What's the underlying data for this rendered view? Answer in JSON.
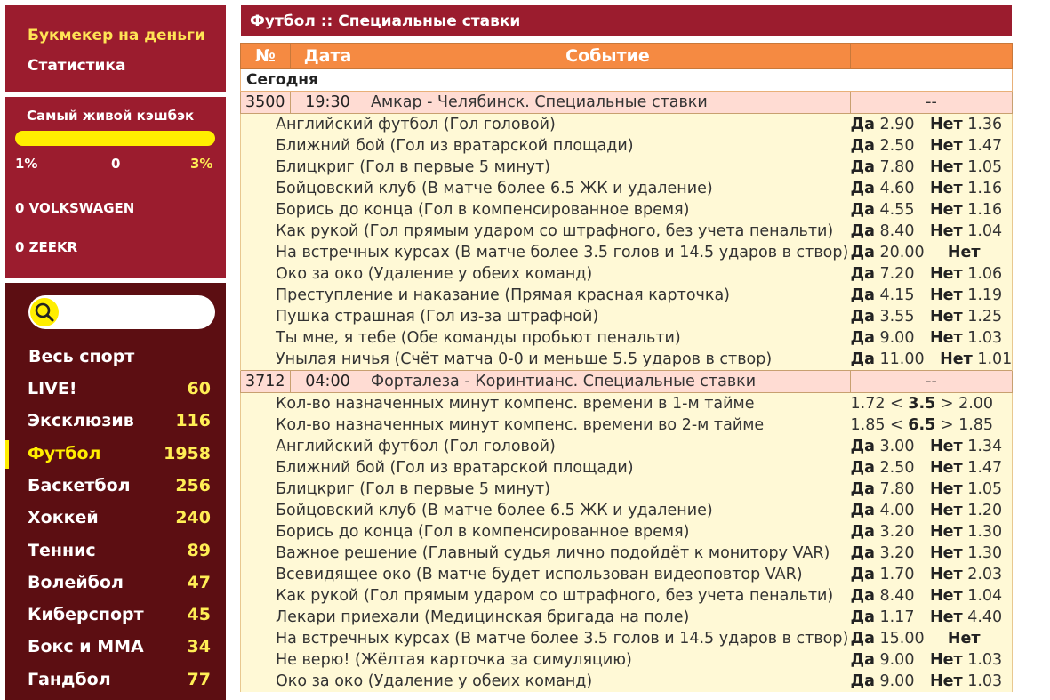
{
  "sidebar": {
    "links": [
      "Букмекер на деньги",
      "Статистика"
    ],
    "cashback": {
      "title": "Самый живой кэшбэк",
      "left": "1%",
      "middle": "0",
      "right": "3%",
      "progress": 0
    },
    "cars": [
      "0 VOLKSWAGEN",
      "0 ZEEKR"
    ],
    "search_placeholder": "",
    "all_sport": "Весь спорт",
    "sports": [
      {
        "name": "LIVE!",
        "count": "60"
      },
      {
        "name": "Эксклюзив",
        "count": "116"
      },
      {
        "name": "Футбол",
        "count": "1958"
      },
      {
        "name": "Баскетбол",
        "count": "256"
      },
      {
        "name": "Хоккей",
        "count": "240"
      },
      {
        "name": "Теннис",
        "count": "89"
      },
      {
        "name": "Волейбол",
        "count": "47"
      },
      {
        "name": "Киберспорт",
        "count": "45"
      },
      {
        "name": "Бокс и MMA",
        "count": "34"
      },
      {
        "name": "Гандбол",
        "count": "77"
      }
    ],
    "active_sport": "Футбол"
  },
  "main": {
    "title": "Футбол :: Специальные ставки",
    "columns": [
      "№",
      "Дата",
      "Событие",
      ""
    ],
    "day_label": "Сегодня",
    "yes": "Да",
    "no": "Нет",
    "events": [
      {
        "num": "3500",
        "time": "19:30",
        "name": "Амкар - Челябинск. Специальные ставки",
        "odds": "--",
        "bets": [
          {
            "label": "Английский футбол (Гол головой)",
            "yes": "2.90",
            "no": "1.36"
          },
          {
            "label": "Ближний бой (Гол из вратарской площади)",
            "yes": "2.50",
            "no": "1.47"
          },
          {
            "label": "Блицкриг (Гол в первые 5 минут)",
            "yes": "7.80",
            "no": "1.05"
          },
          {
            "label": "Бойцовский клуб (В матче более 6.5 ЖК и удаление)",
            "yes": "4.60",
            "no": "1.16"
          },
          {
            "label": "Борись до конца (Гол в компенсированное время)",
            "yes": "4.55",
            "no": "1.16"
          },
          {
            "label": "Как рукой (Гол прямым ударом со штрафного, без учета пенальти)",
            "yes": "8.40",
            "no": "1.04"
          },
          {
            "label": "На встречных курсах (В матче более 3.5 голов и 14.5 ударов в створ)",
            "yes": "20.00",
            "no": ""
          },
          {
            "label": "Око за око (Удаление у обеих команд)",
            "yes": "7.20",
            "no": "1.06"
          },
          {
            "label": "Преступление и наказание (Прямая красная карточка)",
            "yes": "4.15",
            "no": "1.19"
          },
          {
            "label": "Пушка страшная (Гол из-за штрафной)",
            "yes": "3.55",
            "no": "1.25"
          },
          {
            "label": "Ты мне, я тебе (Обе команды пробьют пенальти)",
            "yes": "9.00",
            "no": "1.03"
          },
          {
            "label": "Унылая ничья (Счёт матча 0-0 и меньше 5.5 ударов в створ)",
            "yes": "11.00",
            "no": "1.01"
          }
        ]
      },
      {
        "num": "3712",
        "time": "04:00",
        "name": "Форталеза - Коринтианс. Специальные ставки",
        "odds": "--",
        "totals": [
          {
            "label": "Кол-во назначенных минут компенс. времени в 1-м тайме",
            "under": "1.72",
            "line": "3.5",
            "over": "2.00"
          },
          {
            "label": "Кол-во назначенных минут компенс. времени во 2-м тайме",
            "under": "1.85",
            "line": "6.5",
            "over": "1.85"
          }
        ],
        "bets": [
          {
            "label": "Английский футбол (Гол головой)",
            "yes": "3.00",
            "no": "1.34"
          },
          {
            "label": "Ближний бой (Гол из вратарской площади)",
            "yes": "2.50",
            "no": "1.47"
          },
          {
            "label": "Блицкриг (Гол в первые 5 минут)",
            "yes": "7.80",
            "no": "1.05"
          },
          {
            "label": "Бойцовский клуб (В матче более 6.5 ЖК и удаление)",
            "yes": "4.00",
            "no": "1.20"
          },
          {
            "label": "Борись до конца (Гол в компенсированное время)",
            "yes": "3.20",
            "no": "1.30"
          },
          {
            "label": "Важное решение (Главный судья лично подойдёт к монитору VAR)",
            "yes": "3.20",
            "no": "1.30"
          },
          {
            "label": "Всевидящее око (В матче будет использован видеоповтор VAR)",
            "yes": "1.70",
            "no": "2.03"
          },
          {
            "label": "Как рукой (Гол прямым ударом со штрафного, без учета пенальти)",
            "yes": "8.40",
            "no": "1.04"
          },
          {
            "label": "Лекари приехали (Медицинская бригада на поле)",
            "yes": "1.17",
            "no": "4.40"
          },
          {
            "label": "На встречных курсах (В матче более 3.5 голов и 14.5 ударов в створ)",
            "yes": "15.00",
            "no": ""
          },
          {
            "label": "Не верю! (Жёлтая карточка за симуляцию)",
            "yes": "9.00",
            "no": "1.03"
          },
          {
            "label": "Око за око (Удаление у обеих команд)",
            "yes": "9.00",
            "no": "1.03"
          }
        ]
      }
    ]
  },
  "colors": {
    "sidebar_red": "#9b1c2e",
    "sidebar_dark": "#5c0e12",
    "accent_yellow": "#ffee00",
    "header_orange": "#f58a42",
    "event_row": "#ffdcd3",
    "bet_row": "#fff9d6"
  }
}
